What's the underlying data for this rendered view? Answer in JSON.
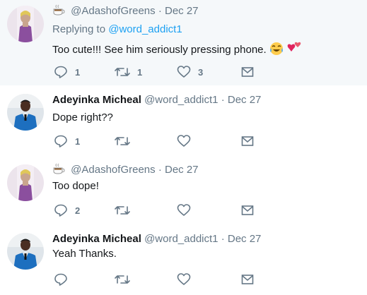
{
  "tweets": [
    {
      "display_name": "",
      "handle": "@AdashofGreens",
      "date": "Dec 27",
      "replying_label": "Replying to",
      "replying_to": "@word_addict1",
      "text": "Too cute!!! See him seriously pressing phone.",
      "reply_count": "1",
      "retweet_count": "1",
      "like_count": "3",
      "avatar": "woman-purple-avatar",
      "name_emoji": "coffee-emoji",
      "text_emojis": [
        "laughing-crying-emoji",
        "two-hearts-emoji"
      ]
    },
    {
      "display_name": "Adeyinka Micheal",
      "handle": "@word_addict1",
      "date": "Dec 27",
      "text": "Dope right??",
      "reply_count": "1",
      "retweet_count": "",
      "like_count": "",
      "avatar": "man-blue-suit-avatar"
    },
    {
      "display_name": "",
      "handle": "@AdashofGreens",
      "date": "Dec 27",
      "text": "Too dope!",
      "reply_count": "2",
      "retweet_count": "",
      "like_count": "",
      "avatar": "woman-purple-avatar",
      "name_emoji": "coffee-emoji"
    },
    {
      "display_name": "Adeyinka Micheal",
      "handle": "@word_addict1",
      "date": "Dec 27",
      "text": "Yeah Thanks.",
      "reply_count": "",
      "retweet_count": "",
      "like_count": "",
      "avatar": "man-blue-suit-avatar"
    }
  ],
  "separator": "·",
  "colors": {
    "link": "#1da1f2",
    "secondary_text": "#657786",
    "thread_line": "#9ad2f5",
    "highlight_bg": "#f5f8fa"
  }
}
